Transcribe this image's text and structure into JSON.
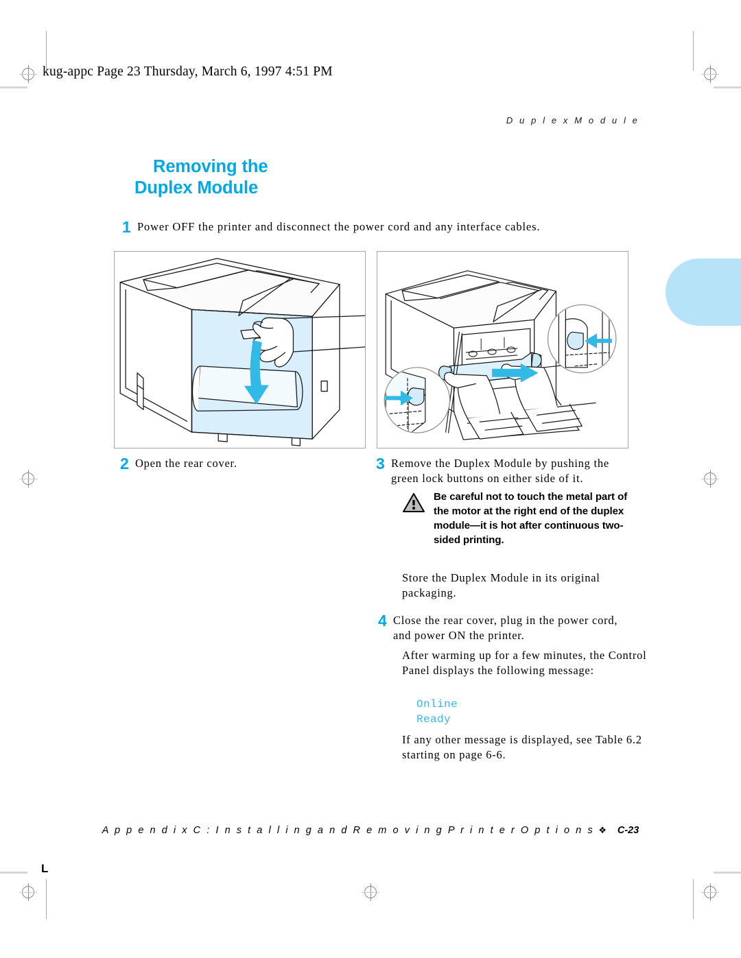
{
  "banner": {
    "text": "kug-appc  Page 23  Thursday, March 6, 1997  4:51 PM"
  },
  "running_head": "D u p l e x   M o d u l e",
  "section_title": {
    "line1": "Removing the",
    "line2": "Duplex Module"
  },
  "steps": [
    {
      "number": "1",
      "text": "Power OFF the printer and disconnect the power cord and any interface cables."
    },
    {
      "number": "2",
      "text": "Open the rear cover."
    },
    {
      "number": "3",
      "text": "Remove the Duplex Module by pushing the green lock buttons on either side of it."
    },
    {
      "number": "4",
      "text": "Close the rear cover, plug in the power cord, and power ON the printer."
    }
  ],
  "caution": {
    "icon": "warning-triangle-icon",
    "text": "Be careful not to touch the metal part of the motor at the right end of the duplex module—it is hot after continuous two-sided printing."
  },
  "paragraphs": {
    "store": "Store the Duplex Module in its original packaging.",
    "warming": "After warming up for a few minutes, the Control Panel displays the following message:",
    "other_message": "If any other message is displayed, see Table 6.2 starting on page 6-6."
  },
  "lcd_message": {
    "line1": "Online",
    "line2": "Ready"
  },
  "footer": {
    "text": "A p p e n d i x   C :   I n s t a l l i n g   a n d   R e m o v i n g   P r i n t e r   O p t i o n s",
    "bullet": "❖",
    "page": "C-23"
  },
  "illustrations": {
    "left": {
      "caption_ref": "2",
      "description": "Printer with hand opening the rear cover, downward cyan arrow"
    },
    "right": {
      "caption_ref": "3",
      "description": "Printer rear with hands removing the Duplex Module, two circular callouts showing green lock buttons"
    }
  },
  "marks": {
    "corner_label": "L"
  },
  "colors": {
    "accent_cyan": "#00a9e6",
    "lcd_cyan": "#38b6ec",
    "tab_blue": "#b7e3f9",
    "illo_tint": "#d6eefb",
    "line": "#1a1a1a"
  }
}
